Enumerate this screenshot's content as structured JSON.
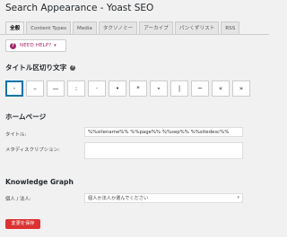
{
  "page_title": "Search Appearance - Yoast SEO",
  "tabs": [
    {
      "label": "全般"
    },
    {
      "label": "Content Types"
    },
    {
      "label": "Media"
    },
    {
      "label": "タクソノミー"
    },
    {
      "label": "アーカイブ"
    },
    {
      "label": "パンくずリスト"
    },
    {
      "label": "RSS"
    }
  ],
  "help": {
    "label": "NEED HELP?",
    "icon": "question-icon"
  },
  "separator_section": {
    "title": "タイトル区切り文字",
    "icon": "help-circle-icon"
  },
  "separators": [
    "-",
    "–",
    "—",
    ":",
    "·",
    "•",
    "*",
    "⋆",
    "|",
    "~",
    "«",
    "»",
    "<",
    ">"
  ],
  "homepage": {
    "title": "ホームページ",
    "title_label": "タイトル:",
    "title_value": "%%sitename%% %%page%% %%sep%% %%sitedesc%%",
    "meta_label": "メタディスクリプション:",
    "meta_value": ""
  },
  "knowledge_graph": {
    "title": "Knowledge Graph",
    "person_label": "個人 / 法人:",
    "person_value": "個人か法人か選んでください"
  },
  "save_label": "変更を保存",
  "colors": {
    "accent": "#a4286a",
    "save": "#dc3232",
    "active_border": "#0073aa"
  }
}
